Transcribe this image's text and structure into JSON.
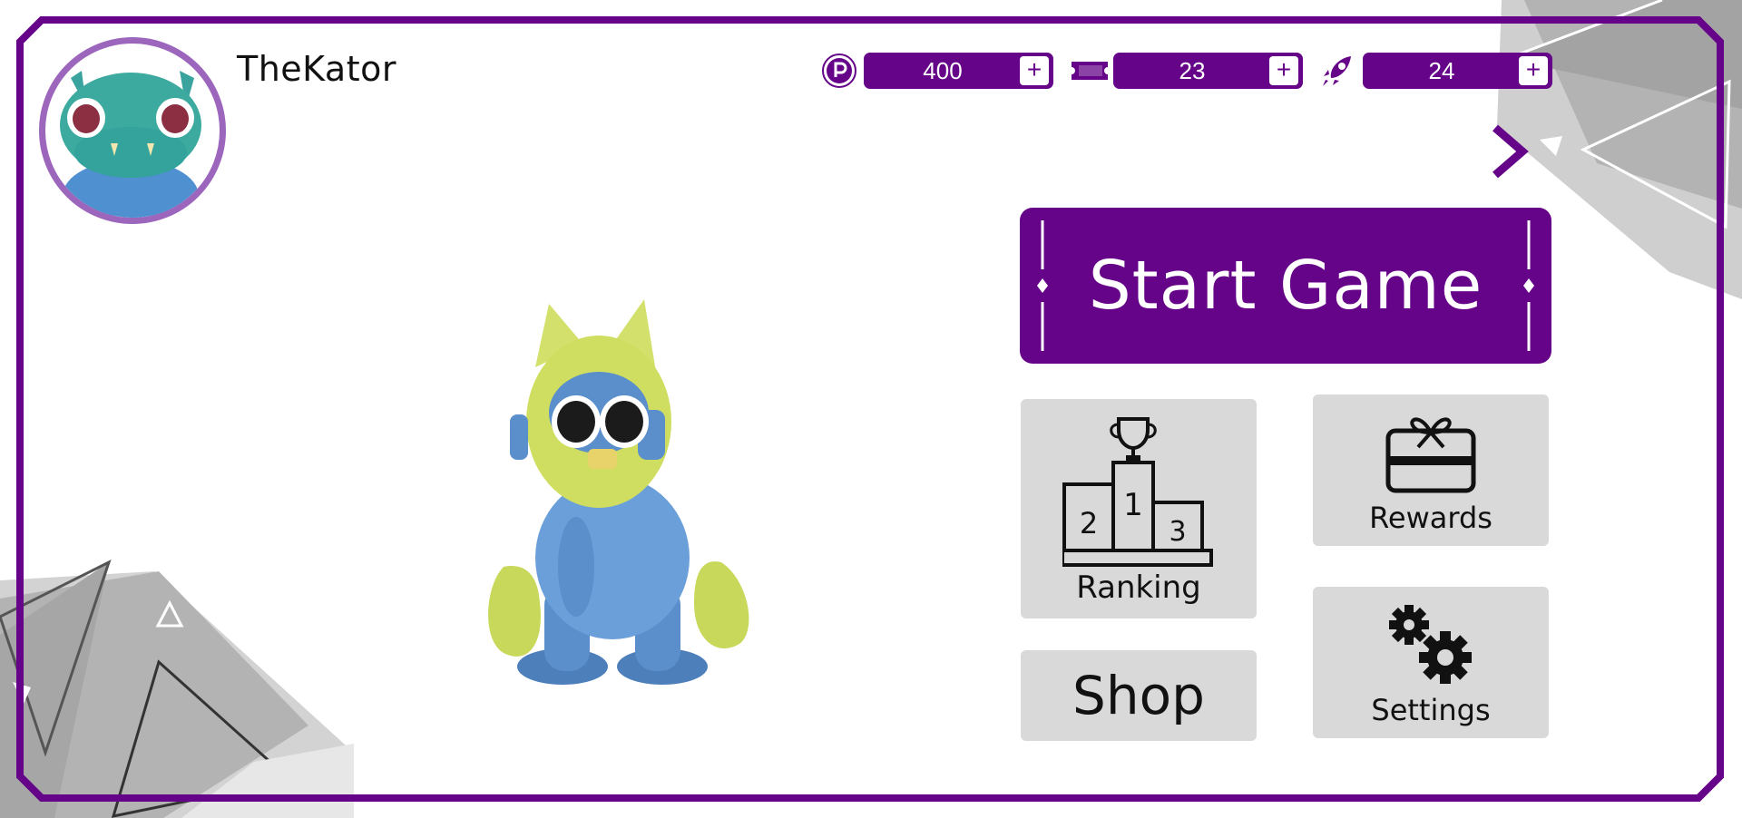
{
  "player": {
    "name": "TheKator"
  },
  "currencies": [
    {
      "icon": "coin-p-icon",
      "value": "400",
      "plus": "+"
    },
    {
      "icon": "ticket-icon",
      "value": "23",
      "plus": "+"
    },
    {
      "icon": "rocket-icon",
      "value": "24",
      "plus": "+"
    }
  ],
  "menu": {
    "start_game": "Start Game",
    "ranking": "Ranking",
    "podium": {
      "first": "1",
      "second": "2",
      "third": "3"
    },
    "rewards": "Rewards",
    "shop": "Shop",
    "settings": "Settings"
  },
  "colors": {
    "accent": "#650489",
    "avatar_ring": "#9d66bd",
    "tile": "#d9d9d9",
    "decor_gray": "#a9a9a9"
  }
}
